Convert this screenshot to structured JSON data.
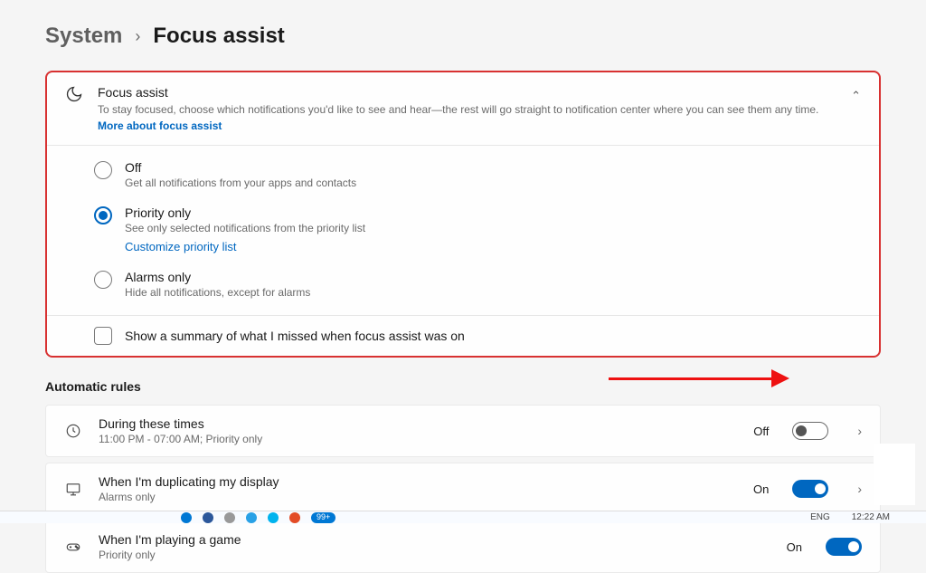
{
  "breadcrumb": {
    "parent": "System",
    "current": "Focus assist"
  },
  "focus": {
    "title": "Focus assist",
    "description": "To stay focused, choose which notifications you'd like to see and hear—the rest will go straight to notification center where you can see them any time.",
    "more_link": "More about focus assist",
    "options": {
      "off": {
        "title": "Off",
        "desc": "Get all notifications from your apps and contacts",
        "selected": false
      },
      "priority": {
        "title": "Priority only",
        "desc": "See only selected notifications from the priority list",
        "link": "Customize priority list",
        "selected": true
      },
      "alarms": {
        "title": "Alarms only",
        "desc": "Hide all notifications, except for alarms",
        "selected": false
      }
    },
    "summary_checkbox": {
      "label": "Show a summary of what I missed when focus assist was on",
      "checked": false
    }
  },
  "rules": {
    "section_title": "Automatic rules",
    "items": [
      {
        "title": "During these times",
        "desc": "11:00 PM - 07:00 AM; Priority only",
        "state": "Off",
        "on": false
      },
      {
        "title": "When I'm duplicating my display",
        "desc": "Alarms only",
        "state": "On",
        "on": true
      },
      {
        "title": "When I'm playing a game",
        "desc": "Priority only",
        "state": "On",
        "on": true
      }
    ]
  },
  "taskbar": {
    "lang": "ENG",
    "time": "12:22 AM",
    "badge": "99+"
  }
}
